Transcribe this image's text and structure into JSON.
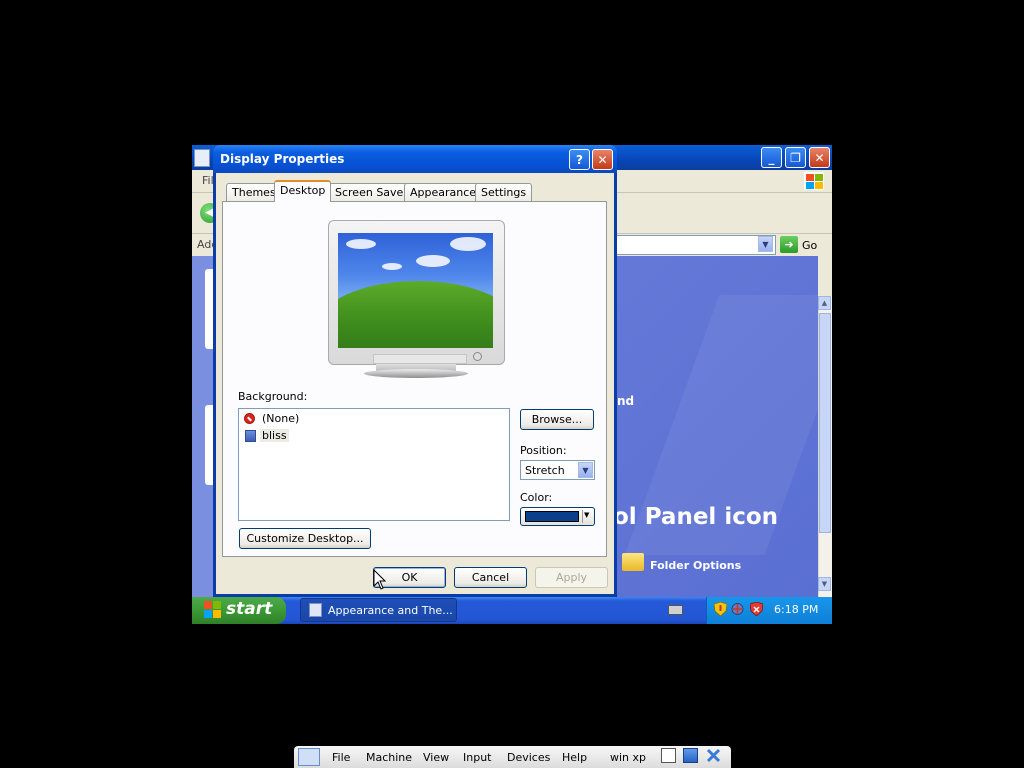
{
  "explorer": {
    "menu_file_partial": "Fil",
    "address_partial": "Add",
    "go_label": "Go",
    "pick_text_partial": "nd",
    "big_text_partial": "ol Panel icon",
    "folder_options_label": "Folder Options"
  },
  "dialog": {
    "title": "Display Properties",
    "help_glyph": "?",
    "close_glyph": "✕",
    "tabs": [
      {
        "label": "Themes",
        "active": false
      },
      {
        "label": "Desktop",
        "active": true
      },
      {
        "label": "Screen Saver",
        "active": false
      },
      {
        "label": "Appearance",
        "active": false
      },
      {
        "label": "Settings",
        "active": false
      }
    ],
    "background_label": "Background:",
    "background_items": [
      {
        "label": "(None)",
        "icon": "no-entry-icon",
        "selected": false
      },
      {
        "label": "bliss",
        "icon": "image-file-icon",
        "selected": true
      }
    ],
    "browse_label": "Browse...",
    "position_label": "Position:",
    "position_value": "Stretch",
    "color_label": "Color:",
    "color_value": "#0a3f8c",
    "customize_label": "Customize Desktop...",
    "ok_label": "OK",
    "cancel_label": "Cancel",
    "apply_label": "Apply"
  },
  "taskbar": {
    "start_label": "start",
    "task_label": "Appearance and The...",
    "clock": "6:18 PM"
  },
  "vm_menu": {
    "items": [
      "File",
      "Machine",
      "View",
      "Input",
      "Devices",
      "Help"
    ],
    "vm_name": "win xp"
  },
  "colors": {
    "title_blue": "#0752d4",
    "dialog_face": "#ece9d8",
    "active_tab_accent": "#e68b2c",
    "start_green": "#3b9a35",
    "tray_blue": "#0f7fd8"
  }
}
